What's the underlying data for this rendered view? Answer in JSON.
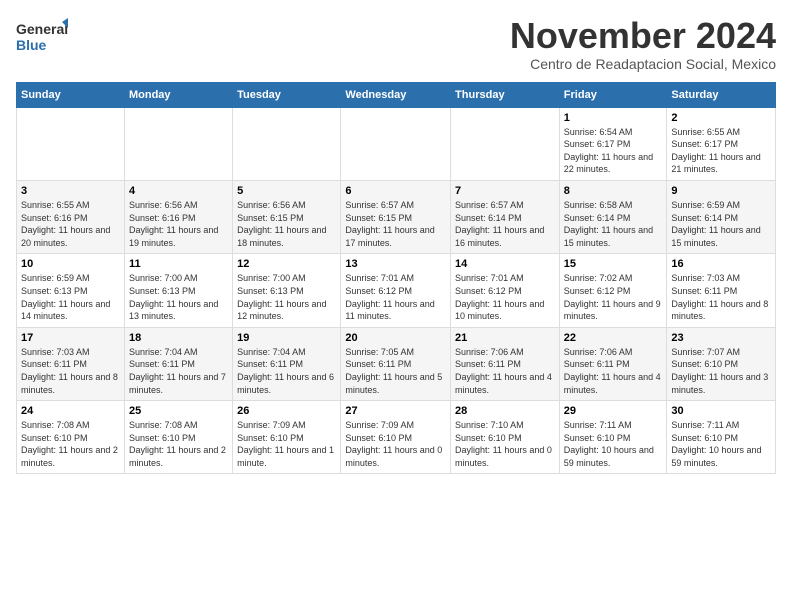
{
  "logo": {
    "general": "General",
    "blue": "Blue"
  },
  "title": "November 2024",
  "subtitle": "Centro de Readaptacion Social, Mexico",
  "days_of_week": [
    "Sunday",
    "Monday",
    "Tuesday",
    "Wednesday",
    "Thursday",
    "Friday",
    "Saturday"
  ],
  "weeks": [
    [
      {
        "day": "",
        "detail": ""
      },
      {
        "day": "",
        "detail": ""
      },
      {
        "day": "",
        "detail": ""
      },
      {
        "day": "",
        "detail": ""
      },
      {
        "day": "",
        "detail": ""
      },
      {
        "day": "1",
        "detail": "Sunrise: 6:54 AM\nSunset: 6:17 PM\nDaylight: 11 hours and 22 minutes."
      },
      {
        "day": "2",
        "detail": "Sunrise: 6:55 AM\nSunset: 6:17 PM\nDaylight: 11 hours and 21 minutes."
      }
    ],
    [
      {
        "day": "3",
        "detail": "Sunrise: 6:55 AM\nSunset: 6:16 PM\nDaylight: 11 hours and 20 minutes."
      },
      {
        "day": "4",
        "detail": "Sunrise: 6:56 AM\nSunset: 6:16 PM\nDaylight: 11 hours and 19 minutes."
      },
      {
        "day": "5",
        "detail": "Sunrise: 6:56 AM\nSunset: 6:15 PM\nDaylight: 11 hours and 18 minutes."
      },
      {
        "day": "6",
        "detail": "Sunrise: 6:57 AM\nSunset: 6:15 PM\nDaylight: 11 hours and 17 minutes."
      },
      {
        "day": "7",
        "detail": "Sunrise: 6:57 AM\nSunset: 6:14 PM\nDaylight: 11 hours and 16 minutes."
      },
      {
        "day": "8",
        "detail": "Sunrise: 6:58 AM\nSunset: 6:14 PM\nDaylight: 11 hours and 15 minutes."
      },
      {
        "day": "9",
        "detail": "Sunrise: 6:59 AM\nSunset: 6:14 PM\nDaylight: 11 hours and 15 minutes."
      }
    ],
    [
      {
        "day": "10",
        "detail": "Sunrise: 6:59 AM\nSunset: 6:13 PM\nDaylight: 11 hours and 14 minutes."
      },
      {
        "day": "11",
        "detail": "Sunrise: 7:00 AM\nSunset: 6:13 PM\nDaylight: 11 hours and 13 minutes."
      },
      {
        "day": "12",
        "detail": "Sunrise: 7:00 AM\nSunset: 6:13 PM\nDaylight: 11 hours and 12 minutes."
      },
      {
        "day": "13",
        "detail": "Sunrise: 7:01 AM\nSunset: 6:12 PM\nDaylight: 11 hours and 11 minutes."
      },
      {
        "day": "14",
        "detail": "Sunrise: 7:01 AM\nSunset: 6:12 PM\nDaylight: 11 hours and 10 minutes."
      },
      {
        "day": "15",
        "detail": "Sunrise: 7:02 AM\nSunset: 6:12 PM\nDaylight: 11 hours and 9 minutes."
      },
      {
        "day": "16",
        "detail": "Sunrise: 7:03 AM\nSunset: 6:11 PM\nDaylight: 11 hours and 8 minutes."
      }
    ],
    [
      {
        "day": "17",
        "detail": "Sunrise: 7:03 AM\nSunset: 6:11 PM\nDaylight: 11 hours and 8 minutes."
      },
      {
        "day": "18",
        "detail": "Sunrise: 7:04 AM\nSunset: 6:11 PM\nDaylight: 11 hours and 7 minutes."
      },
      {
        "day": "19",
        "detail": "Sunrise: 7:04 AM\nSunset: 6:11 PM\nDaylight: 11 hours and 6 minutes."
      },
      {
        "day": "20",
        "detail": "Sunrise: 7:05 AM\nSunset: 6:11 PM\nDaylight: 11 hours and 5 minutes."
      },
      {
        "day": "21",
        "detail": "Sunrise: 7:06 AM\nSunset: 6:11 PM\nDaylight: 11 hours and 4 minutes."
      },
      {
        "day": "22",
        "detail": "Sunrise: 7:06 AM\nSunset: 6:11 PM\nDaylight: 11 hours and 4 minutes."
      },
      {
        "day": "23",
        "detail": "Sunrise: 7:07 AM\nSunset: 6:10 PM\nDaylight: 11 hours and 3 minutes."
      }
    ],
    [
      {
        "day": "24",
        "detail": "Sunrise: 7:08 AM\nSunset: 6:10 PM\nDaylight: 11 hours and 2 minutes."
      },
      {
        "day": "25",
        "detail": "Sunrise: 7:08 AM\nSunset: 6:10 PM\nDaylight: 11 hours and 2 minutes."
      },
      {
        "day": "26",
        "detail": "Sunrise: 7:09 AM\nSunset: 6:10 PM\nDaylight: 11 hours and 1 minute."
      },
      {
        "day": "27",
        "detail": "Sunrise: 7:09 AM\nSunset: 6:10 PM\nDaylight: 11 hours and 0 minutes."
      },
      {
        "day": "28",
        "detail": "Sunrise: 7:10 AM\nSunset: 6:10 PM\nDaylight: 11 hours and 0 minutes."
      },
      {
        "day": "29",
        "detail": "Sunrise: 7:11 AM\nSunset: 6:10 PM\nDaylight: 10 hours and 59 minutes."
      },
      {
        "day": "30",
        "detail": "Sunrise: 7:11 AM\nSunset: 6:10 PM\nDaylight: 10 hours and 59 minutes."
      }
    ]
  ]
}
